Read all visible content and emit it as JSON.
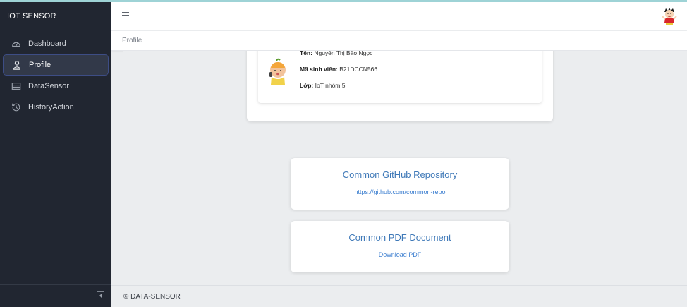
{
  "sidebar": {
    "brand": "IOT SENSOR",
    "items": [
      {
        "label": "Dashboard",
        "icon": "speedometer-icon"
      },
      {
        "label": "Profile",
        "icon": "user-icon"
      },
      {
        "label": "DataSensor",
        "icon": "table-icon"
      },
      {
        "label": "HistoryAction",
        "icon": "history-icon"
      }
    ],
    "active_item": "Profile"
  },
  "header": {
    "menu_icon": "hamburger-icon",
    "breadcrumb": "Profile"
  },
  "profile": {
    "name_label": "Tên:",
    "name_value": "Nguyễn Thị Bảo Ngọc",
    "id_label": "Mã sinh viên:",
    "id_value": "B21DCCN566",
    "class_label": "Lớp:",
    "class_value": "IoT nhóm 5"
  },
  "cards": {
    "github": {
      "title": "Common GitHub Repository",
      "link": "https://github.com/common-repo"
    },
    "pdf": {
      "title": "Common PDF Document",
      "link": "Download PDF"
    }
  },
  "footer": {
    "text": "© DATA-SENSOR"
  },
  "colors": {
    "sidebar_bg": "#212631",
    "accent_link": "#3d7fd0",
    "active_border": "#3d4d85"
  }
}
